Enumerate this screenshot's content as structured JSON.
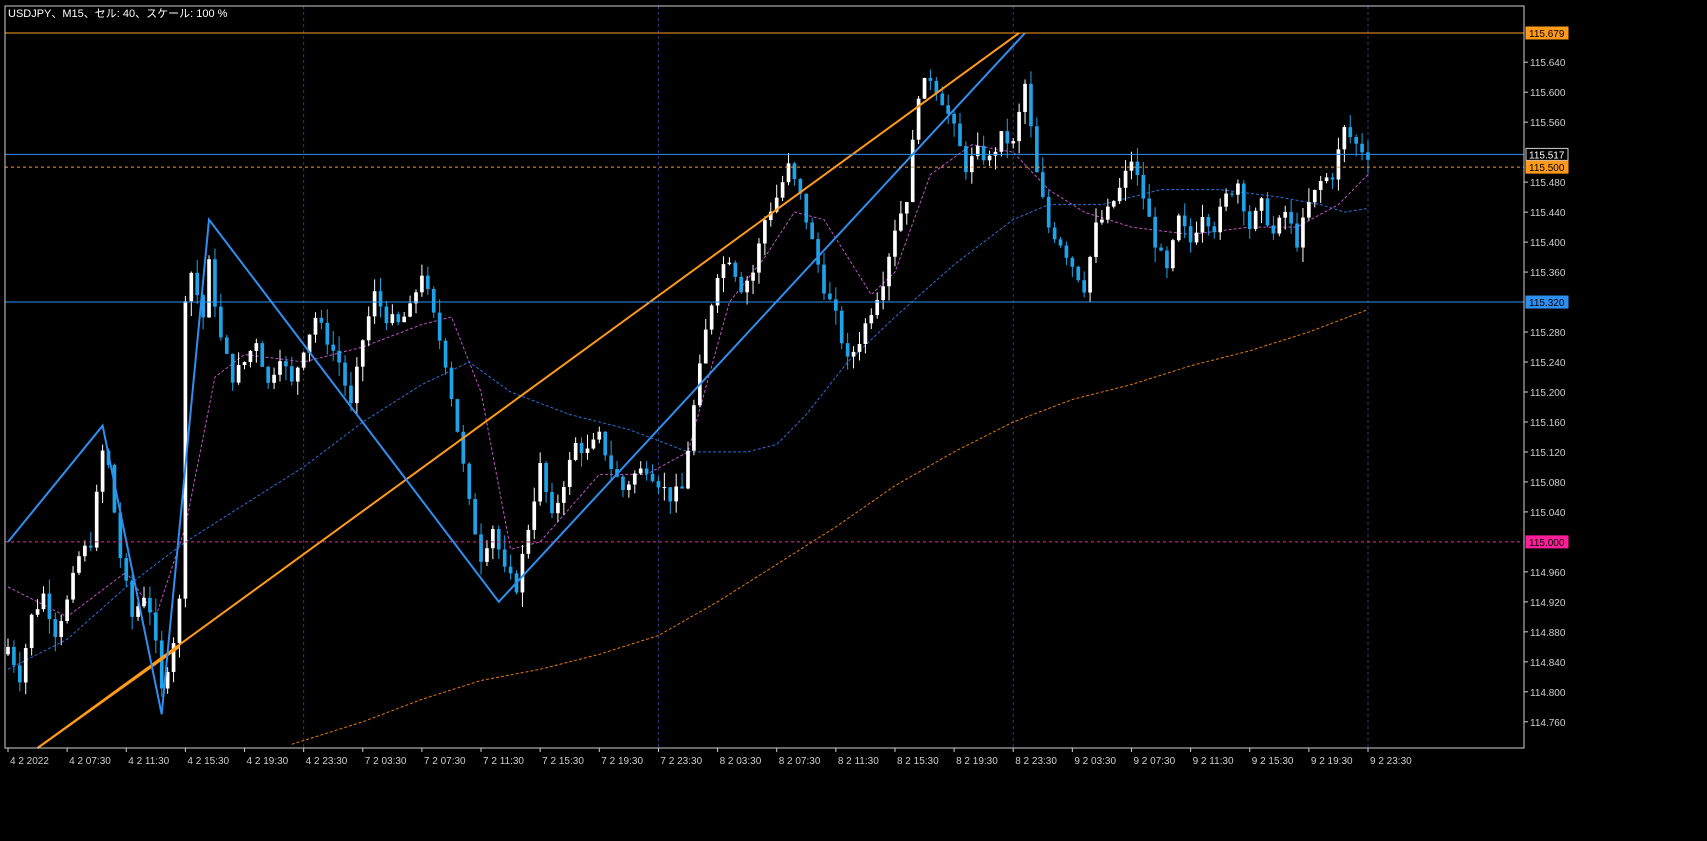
{
  "header": {
    "text": "USDJPY、M15、セル: 40、スケール: 100 %"
  },
  "colors": {
    "background": "#000000",
    "frame": "#cfcfcf",
    "axis_text": "#cfcfcf",
    "grid": "#2c3a86",
    "bull_candle": "#ffffff",
    "bear_candle": "#1ea2e8",
    "orange": "#ff9a1a",
    "blue_line": "#2e8ff0",
    "pink": "#ff1f9a",
    "violet_ma": "#c052c8",
    "blue_ma": "#2a6fd8",
    "orange_ma": "#e07a12",
    "current_price_bg": "#000000"
  },
  "chart_data": {
    "type": "candlestick",
    "symbol": "USDJPY",
    "timeframe": "M15",
    "ylim": [
      114.725,
      115.715
    ],
    "price_ticks": [
      "115.640",
      "115.600",
      "115.560",
      "115.480",
      "115.440",
      "115.400",
      "115.360",
      "115.280",
      "115.240",
      "115.200",
      "115.160",
      "115.120",
      "115.080",
      "115.040",
      "114.960",
      "114.920",
      "114.880",
      "114.840",
      "114.800",
      "114.760"
    ],
    "time_ticks": [
      {
        "label": "4 2 2022",
        "bar": 0
      },
      {
        "label": "4 2 07:30",
        "bar": 10
      },
      {
        "label": "4 2 11:30",
        "bar": 20
      },
      {
        "label": "4 2 15:30",
        "bar": 30
      },
      {
        "label": "4 2 19:30",
        "bar": 40
      },
      {
        "label": "4 2 23:30",
        "bar": 50
      },
      {
        "label": "7 2 03:30",
        "bar": 60
      },
      {
        "label": "7 2 07:30",
        "bar": 70
      },
      {
        "label": "7 2 11:30",
        "bar": 80
      },
      {
        "label": "7 2 15:30",
        "bar": 90
      },
      {
        "label": "7 2 19:30",
        "bar": 100
      },
      {
        "label": "7 2 23:30",
        "bar": 110
      },
      {
        "label": "8 2 03:30",
        "bar": 120
      },
      {
        "label": "8 2 07:30",
        "bar": 130
      },
      {
        "label": "8 2 11:30",
        "bar": 140
      },
      {
        "label": "8 2 15:30",
        "bar": 150
      },
      {
        "label": "8 2 19:30",
        "bar": 160
      },
      {
        "label": "8 2 23:30",
        "bar": 170
      },
      {
        "label": "9 2 03:30",
        "bar": 180
      },
      {
        "label": "9 2 07:30",
        "bar": 190
      },
      {
        "label": "9 2 11:30",
        "bar": 200
      },
      {
        "label": "9 2 15:30",
        "bar": 210
      },
      {
        "label": "9 2 19:30",
        "bar": 220
      },
      {
        "label": "9 2 23:30",
        "bar": 230
      }
    ],
    "vertical_separators": [
      50,
      110,
      170,
      230
    ],
    "close_path": [
      [
        0,
        114.86
      ],
      [
        2,
        114.82
      ],
      [
        4,
        114.9
      ],
      [
        6,
        114.93
      ],
      [
        8,
        114.88
      ],
      [
        10,
        114.92
      ],
      [
        12,
        114.98
      ],
      [
        14,
        115.0
      ],
      [
        16,
        115.12
      ],
      [
        17,
        115.1
      ],
      [
        19,
        114.98
      ],
      [
        21,
        114.9
      ],
      [
        23,
        114.93
      ],
      [
        24,
        114.91
      ],
      [
        25,
        114.86
      ],
      [
        26,
        114.8
      ],
      [
        28,
        114.87
      ],
      [
        29,
        114.92
      ],
      [
        30,
        115.33
      ],
      [
        31,
        115.36
      ],
      [
        33,
        115.3
      ],
      [
        34,
        115.37
      ],
      [
        36,
        115.27
      ],
      [
        38,
        115.22
      ],
      [
        40,
        115.24
      ],
      [
        42,
        115.27
      ],
      [
        44,
        115.21
      ],
      [
        46,
        115.25
      ],
      [
        48,
        115.21
      ],
      [
        50,
        115.26
      ],
      [
        52,
        115.3
      ],
      [
        54,
        115.27
      ],
      [
        56,
        115.24
      ],
      [
        58,
        115.18
      ],
      [
        60,
        115.27
      ],
      [
        62,
        115.33
      ],
      [
        64,
        115.3
      ],
      [
        66,
        115.29
      ],
      [
        68,
        115.31
      ],
      [
        70,
        115.36
      ],
      [
        72,
        115.3
      ],
      [
        74,
        115.24
      ],
      [
        76,
        115.15
      ],
      [
        78,
        115.05
      ],
      [
        80,
        114.98
      ],
      [
        82,
        115.02
      ],
      [
        84,
        114.96
      ],
      [
        86,
        114.94
      ],
      [
        88,
        115.02
      ],
      [
        90,
        115.1
      ],
      [
        92,
        115.03
      ],
      [
        94,
        115.08
      ],
      [
        96,
        115.13
      ],
      [
        98,
        115.12
      ],
      [
        100,
        115.14
      ],
      [
        102,
        115.1
      ],
      [
        104,
        115.07
      ],
      [
        106,
        115.09
      ],
      [
        108,
        115.1
      ],
      [
        110,
        115.08
      ],
      [
        112,
        115.06
      ],
      [
        114,
        115.07
      ],
      [
        116,
        115.18
      ],
      [
        118,
        115.28
      ],
      [
        120,
        115.36
      ],
      [
        122,
        115.38
      ],
      [
        124,
        115.34
      ],
      [
        126,
        115.36
      ],
      [
        128,
        115.43
      ],
      [
        130,
        115.46
      ],
      [
        132,
        115.5
      ],
      [
        134,
        115.46
      ],
      [
        136,
        115.4
      ],
      [
        138,
        115.34
      ],
      [
        140,
        115.3
      ],
      [
        142,
        115.24
      ],
      [
        144,
        115.27
      ],
      [
        146,
        115.31
      ],
      [
        148,
        115.35
      ],
      [
        150,
        115.42
      ],
      [
        152,
        115.46
      ],
      [
        154,
        115.6
      ],
      [
        156,
        115.62
      ],
      [
        158,
        115.59
      ],
      [
        160,
        115.55
      ],
      [
        162,
        115.5
      ],
      [
        164,
        115.52
      ],
      [
        166,
        115.51
      ],
      [
        168,
        115.54
      ],
      [
        170,
        115.53
      ],
      [
        171,
        115.57
      ],
      [
        172,
        115.61
      ],
      [
        174,
        115.49
      ],
      [
        176,
        115.42
      ],
      [
        178,
        115.4
      ],
      [
        180,
        115.37
      ],
      [
        182,
        115.34
      ],
      [
        184,
        115.42
      ],
      [
        186,
        115.44
      ],
      [
        188,
        115.47
      ],
      [
        190,
        115.51
      ],
      [
        192,
        115.46
      ],
      [
        194,
        115.4
      ],
      [
        196,
        115.36
      ],
      [
        198,
        115.43
      ],
      [
        200,
        115.4
      ],
      [
        202,
        115.44
      ],
      [
        204,
        115.42
      ],
      [
        206,
        115.46
      ],
      [
        208,
        115.48
      ],
      [
        210,
        115.42
      ],
      [
        212,
        115.45
      ],
      [
        214,
        115.41
      ],
      [
        216,
        115.44
      ],
      [
        218,
        115.4
      ],
      [
        220,
        115.45
      ],
      [
        222,
        115.48
      ],
      [
        224,
        115.49
      ],
      [
        226,
        115.55
      ],
      [
        228,
        115.53
      ],
      [
        230,
        115.517
      ]
    ],
    "candle_count": 231,
    "overlays": {
      "violet_ma": [
        [
          0,
          114.94
        ],
        [
          10,
          114.9
        ],
        [
          20,
          114.96
        ],
        [
          25,
          114.9
        ],
        [
          30,
          115.02
        ],
        [
          35,
          115.22
        ],
        [
          40,
          115.25
        ],
        [
          50,
          115.24
        ],
        [
          60,
          115.26
        ],
        [
          70,
          115.29
        ],
        [
          75,
          115.3
        ],
        [
          80,
          115.2
        ],
        [
          85,
          114.99
        ],
        [
          90,
          115.0
        ],
        [
          100,
          115.09
        ],
        [
          108,
          115.09
        ],
        [
          115,
          115.12
        ],
        [
          122,
          115.32
        ],
        [
          128,
          115.38
        ],
        [
          133,
          115.44
        ],
        [
          138,
          115.43
        ],
        [
          142,
          115.38
        ],
        [
          146,
          115.33
        ],
        [
          150,
          115.36
        ],
        [
          156,
          115.49
        ],
        [
          163,
          115.53
        ],
        [
          170,
          115.52
        ],
        [
          176,
          115.47
        ],
        [
          182,
          115.44
        ],
        [
          190,
          115.42
        ],
        [
          200,
          115.41
        ],
        [
          210,
          115.42
        ],
        [
          218,
          115.42
        ],
        [
          225,
          115.45
        ],
        [
          230,
          115.49
        ]
      ],
      "blue_ma": [
        [
          0,
          114.83
        ],
        [
          10,
          114.87
        ],
        [
          20,
          114.94
        ],
        [
          30,
          115.0
        ],
        [
          40,
          115.05
        ],
        [
          50,
          115.1
        ],
        [
          60,
          115.16
        ],
        [
          70,
          115.21
        ],
        [
          78,
          115.24
        ],
        [
          85,
          115.2
        ],
        [
          95,
          115.17
        ],
        [
          105,
          115.15
        ],
        [
          115,
          115.12
        ],
        [
          125,
          115.12
        ],
        [
          130,
          115.13
        ],
        [
          135,
          115.17
        ],
        [
          142,
          115.24
        ],
        [
          150,
          115.3
        ],
        [
          160,
          115.37
        ],
        [
          170,
          115.43
        ],
        [
          176,
          115.45
        ],
        [
          185,
          115.45
        ],
        [
          195,
          115.47
        ],
        [
          205,
          115.47
        ],
        [
          215,
          115.46
        ],
        [
          222,
          115.45
        ],
        [
          226,
          115.44
        ],
        [
          230,
          115.445
        ]
      ],
      "orange_ma": [
        [
          48,
          114.73
        ],
        [
          60,
          114.76
        ],
        [
          70,
          114.79
        ],
        [
          80,
          114.815
        ],
        [
          90,
          114.83
        ],
        [
          100,
          114.85
        ],
        [
          110,
          114.875
        ],
        [
          120,
          114.92
        ],
        [
          130,
          114.97
        ],
        [
          140,
          115.02
        ],
        [
          150,
          115.075
        ],
        [
          160,
          115.12
        ],
        [
          170,
          115.16
        ],
        [
          180,
          115.19
        ],
        [
          190,
          115.21
        ],
        [
          200,
          115.235
        ],
        [
          210,
          115.255
        ],
        [
          220,
          115.28
        ],
        [
          230,
          115.31
        ]
      ]
    },
    "trendlines": {
      "orange_channel": [
        {
          "from": [
            5,
            114.725
          ],
          "to": [
            171,
            115.679
          ]
        },
        {
          "from": [
            5,
            114.725
          ],
          "to": [
            29,
            114.86
          ]
        }
      ],
      "blue_zigzag": [
        [
          0,
          115.0
        ],
        [
          16,
          115.155
        ],
        [
          26,
          114.77
        ],
        [
          34,
          115.43
        ],
        [
          83,
          114.92
        ],
        [
          172,
          115.679
        ]
      ]
    },
    "horizontal_lines": [
      {
        "price": 115.679,
        "label": "115.679",
        "color": "#ff9a1a",
        "style": "solid",
        "tag_fill": "#ff9a1a",
        "tag_text": "#000000"
      },
      {
        "price": 115.517,
        "label": "115.517",
        "color": "#2e8ff0",
        "style": "solid",
        "tag_fill": "#000000",
        "tag_text": "#ffffff"
      },
      {
        "price": 115.5,
        "label": "115.500",
        "color": "#ff9a1a",
        "style": "dash",
        "tag_fill": "#ff9a1a",
        "tag_text": "#000000"
      },
      {
        "price": 115.32,
        "label": "115.320",
        "color": "#2e8ff0",
        "style": "solid",
        "tag_fill": "#2e8ff0",
        "tag_text": "#000000"
      },
      {
        "price": 115.0,
        "label": "115.000",
        "color": "#ff1f9a",
        "style": "dash",
        "tag_fill": "#ff1f9a",
        "tag_text": "#000000"
      }
    ],
    "current_price": 115.517
  }
}
